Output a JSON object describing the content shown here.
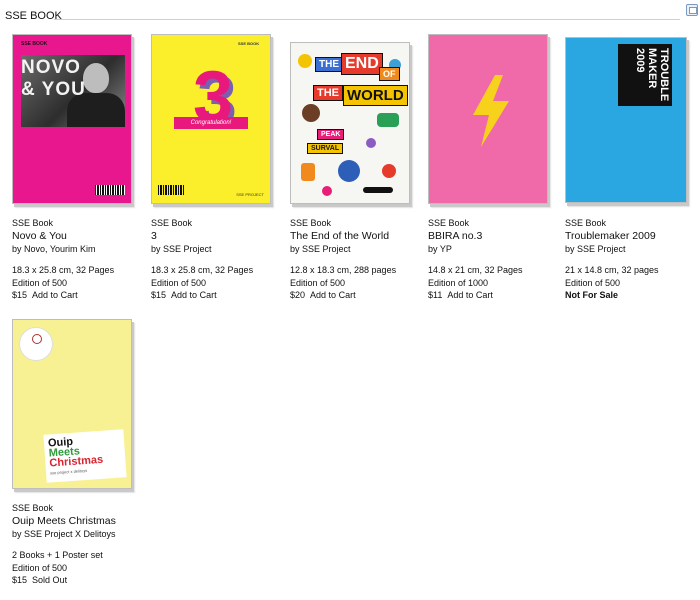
{
  "header": {
    "title": "SSE BOOK"
  },
  "products": [
    {
      "publisher": "SSE Book",
      "title": "Novo & You",
      "author": "by Novo, Yourim Kim",
      "spec": "18.3 x 25.8 cm, 32 Pages",
      "edition": "Edition of 500",
      "price": "$15",
      "action": "Add to Cart",
      "cover": {
        "brand": "SSE BOOK",
        "title_line1": "NOVO",
        "title_line2": "& YOU"
      }
    },
    {
      "publisher": "SSE Book",
      "title": "3",
      "author": "by SSE Project",
      "spec": "18.3 x 25.8 cm, 32 Pages",
      "edition": "Edition of 500",
      "price": "$15",
      "action": "Add to Cart",
      "cover": {
        "brand": "SSE BOOK",
        "big": "3",
        "ribbon": "Congratulation!",
        "foot": "SSE PROJECT"
      }
    },
    {
      "publisher": "SSE Book",
      "title": "The End of the World",
      "author": "by SSE Project",
      "spec": "12.8 x 18.3 cm, 288 pages",
      "edition": "Edition of 500",
      "price": "$20",
      "action": "Add to Cart",
      "cover": {
        "w1": "THE",
        "w2": "END",
        "w3": "OF",
        "w4": "THE",
        "w5": "WORLD",
        "w6": "PEAK",
        "w7": "SURVAL"
      }
    },
    {
      "publisher": "SSE Book",
      "title": "BBIRA no.3",
      "author": "by YP",
      "spec": "14.8 x 21 cm, 32 Pages",
      "edition": "Edition of 1000",
      "price": "$11",
      "action": "Add to Cart"
    },
    {
      "publisher": "SSE Book",
      "title": "Troublemaker 2009",
      "author": "by SSE Project",
      "spec": "21 x 14.8 cm, 32 pages",
      "edition": "Edition of 500",
      "price": "",
      "action": "Not For Sale",
      "cover": {
        "line1": "TROUBLE",
        "line2": "MAKER",
        "line3": "2009"
      }
    },
    {
      "publisher": "SSE Book",
      "title": "Ouip Meets Christmas",
      "author": "by SSE Project X Delitoys",
      "spec": "2 Books + 1 Poster set",
      "edition": "Edition of 500",
      "price": "$15",
      "action": "Sold Out",
      "cover": {
        "l1": "Ouip",
        "l2": "Meets",
        "l3": "Christmas",
        "l4": "sse project x delitoys"
      }
    }
  ],
  "colors": {
    "novo": "#e8178d",
    "three": "#fbef2b",
    "end": "#f6f6f3",
    "bbira": "#f06aa9",
    "trouble": "#2aa7e0",
    "ouip": "#f8f193"
  }
}
